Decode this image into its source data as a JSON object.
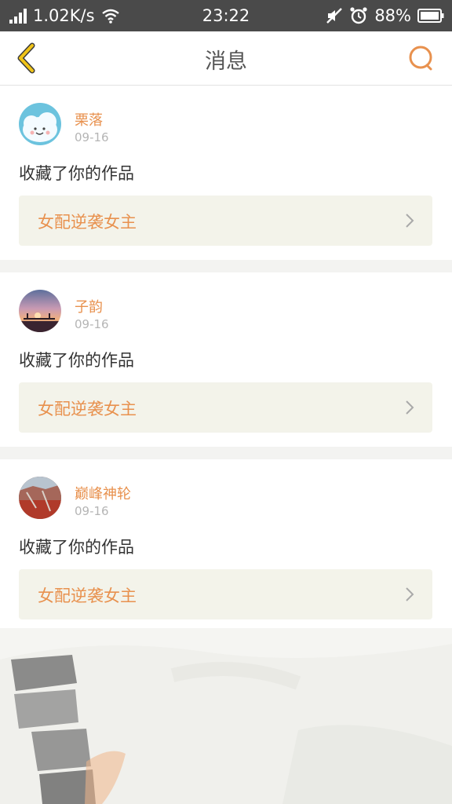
{
  "status_bar": {
    "network_speed": "1.02K/s",
    "time": "23:22",
    "battery": "88%"
  },
  "header": {
    "title": "消息"
  },
  "messages": [
    {
      "name": "栗落",
      "date": "09-16",
      "action": "收藏了你的作品",
      "work_title": "女配逆袭女主"
    },
    {
      "name": "子韵",
      "date": "09-16",
      "action": "收藏了你的作品",
      "work_title": "女配逆袭女主"
    },
    {
      "name": "巅峰神轮",
      "date": "09-16",
      "action": "收藏了你的作品",
      "work_title": "女配逆袭女主"
    }
  ],
  "colors": {
    "accent": "#e8914e",
    "back_icon": "#f0c419",
    "card_link_bg": "#f3f3ea"
  },
  "icons": {
    "back": "chevron-left-icon",
    "search": "search-icon",
    "work_arrow": "chevron-right-icon"
  }
}
